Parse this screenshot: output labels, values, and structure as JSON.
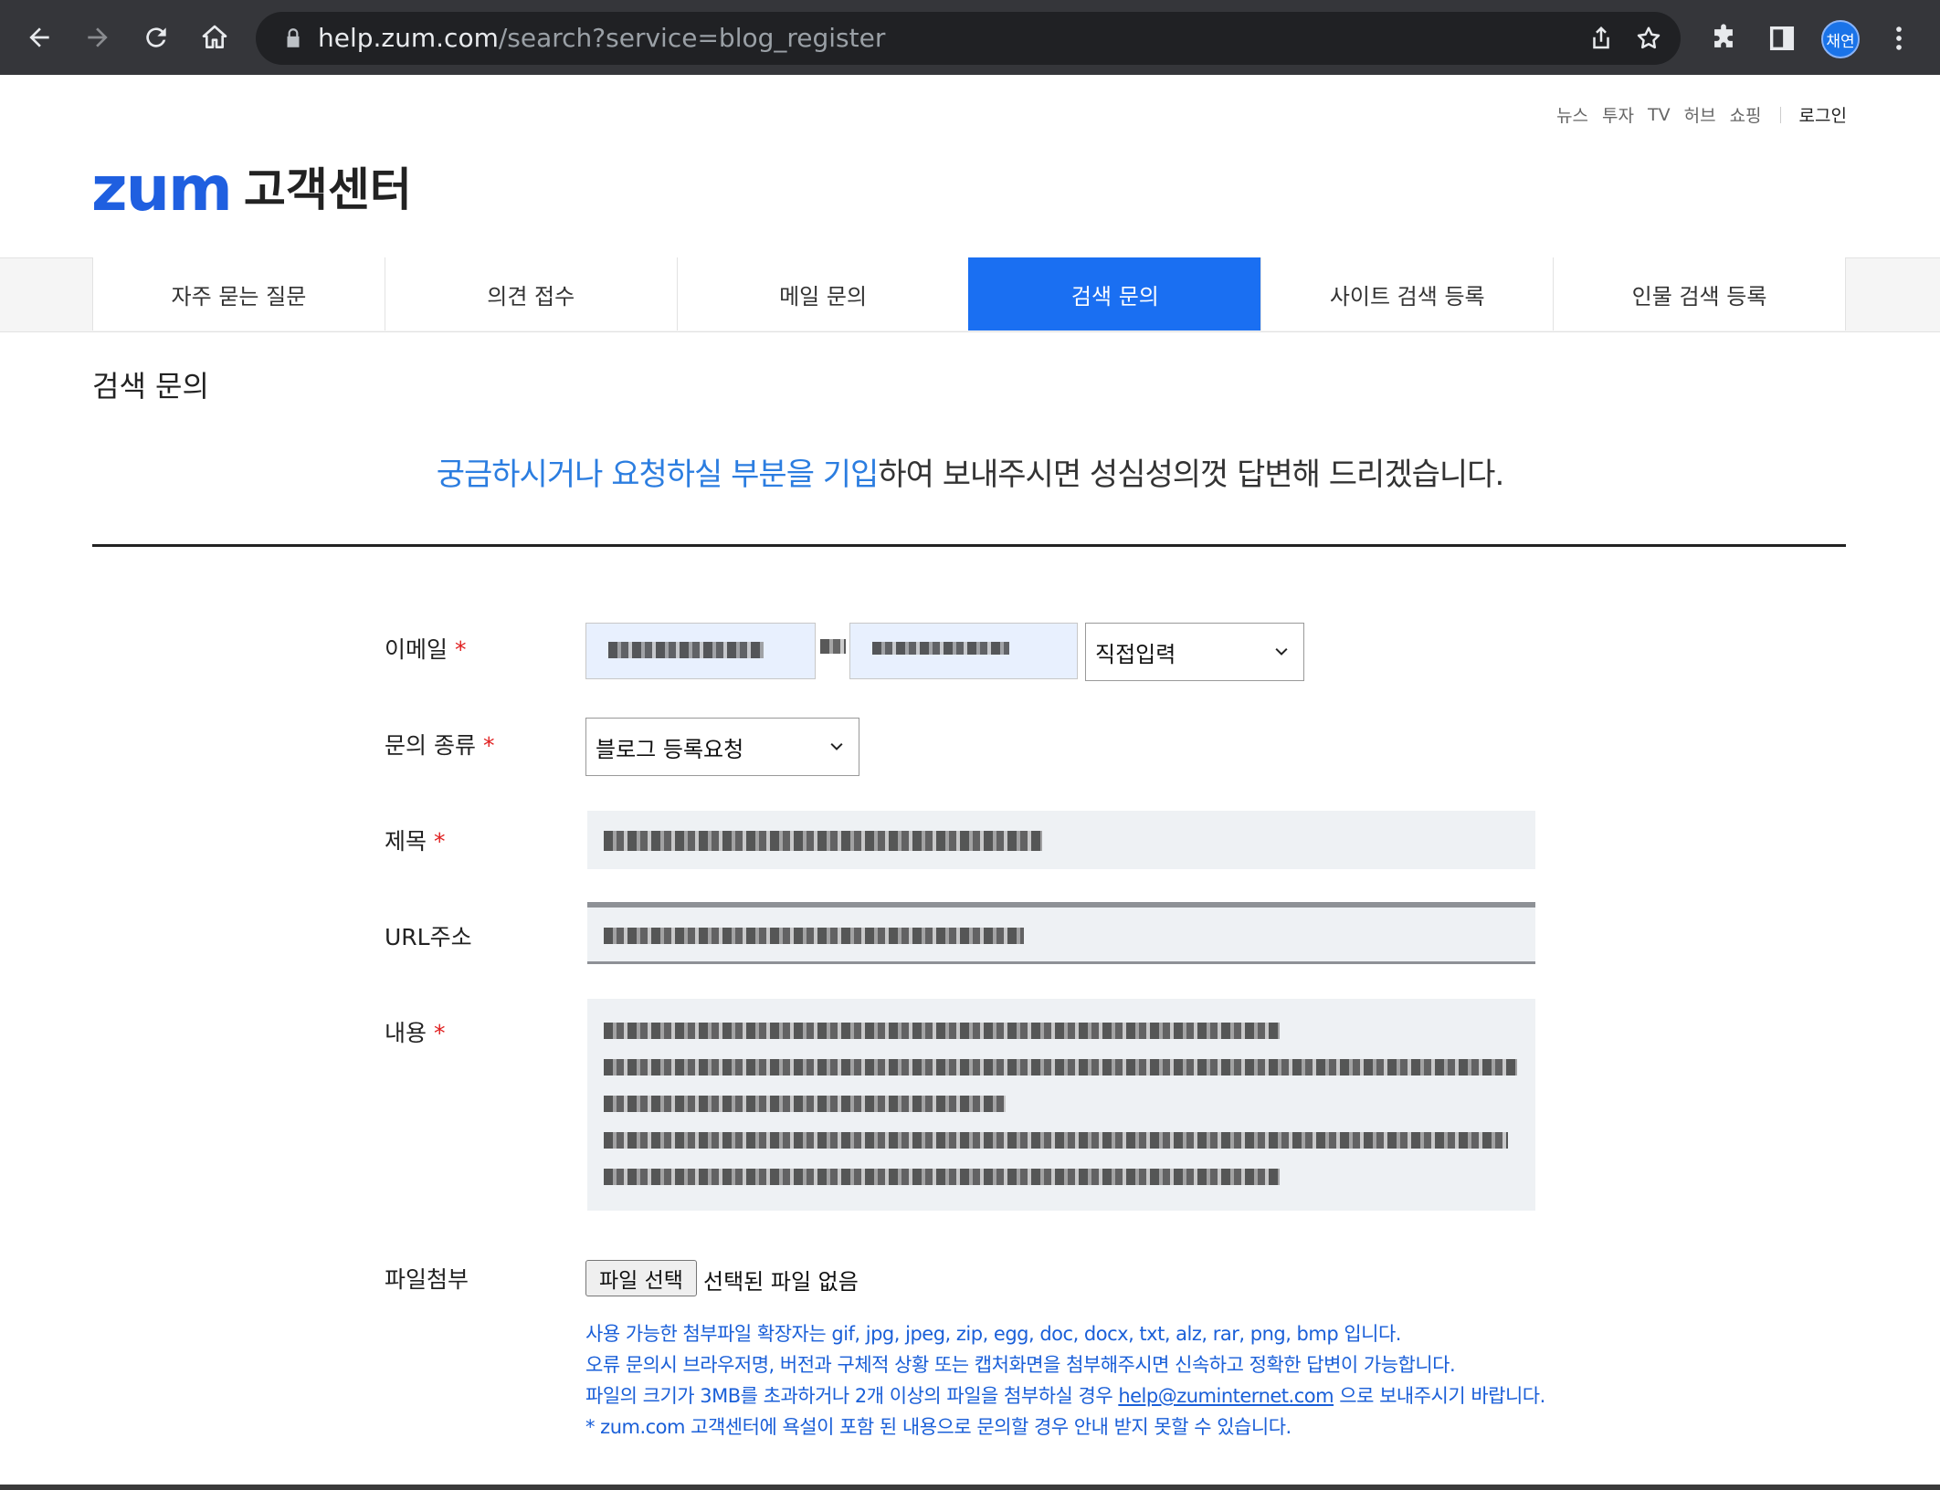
{
  "browser": {
    "url_host": "help.zum.com",
    "url_path": "/search?service=blog_register",
    "profile_initials": "채연"
  },
  "topnav": {
    "items": [
      "뉴스",
      "투자",
      "TV",
      "허브",
      "쇼핑"
    ],
    "login": "로그인"
  },
  "logo": {
    "brand": "zum",
    "subtitle": "고객센터",
    "brand_color": "#1f5fe0"
  },
  "tabs": [
    {
      "label": "자주 묻는 질문",
      "active": false
    },
    {
      "label": "의견 접수",
      "active": false
    },
    {
      "label": "메일 문의",
      "active": false
    },
    {
      "label": "검색 문의",
      "active": true
    },
    {
      "label": "사이트 검색 등록",
      "active": false
    },
    {
      "label": "인물 검색 등록",
      "active": false
    }
  ],
  "page": {
    "title": "검색 문의",
    "intro_highlight": "궁금하시거나 요청하실 부분을 기입",
    "intro_rest": "하여 보내주시면 성심성의껏 답변해 드리겠습니다.",
    "accent_color": "#1a6ff2"
  },
  "form": {
    "email_label": "이메일",
    "email_domain_select": "직접입력",
    "type_label": "문의 종류",
    "type_select": "블로그 등록요청",
    "subject_label": "제목",
    "url_label": "URL주소",
    "content_label": "내용",
    "attach_label": "파일첨부",
    "required_mark": "*",
    "file_button": "파일 선택",
    "file_status": "선택된 파일 없음",
    "notes": [
      "사용 가능한 첨부파일 확장자는 gif, jpg, jpeg, zip, egg, doc, docx, txt, alz, rar, png, bmp 입니다.",
      "오류 문의시 브라우저명, 버전과 구체적 상황 또는 캡처화면을 첨부해주시면 신속하고 정확한 답변이 가능합니다."
    ],
    "note3_pre": "파일의 크기가 3MB를 초과하거나 2개 이상의 파일을 첨부하실 경우 ",
    "note3_mail": "help@zuminternet.com",
    "note3_post": " 으로 보내주시기 바랍니다.",
    "note4": " * zum.com 고객센터에 욕설이 포함 된 내용으로 문의할 경우 안내 받지 못할 수 있습니다."
  }
}
